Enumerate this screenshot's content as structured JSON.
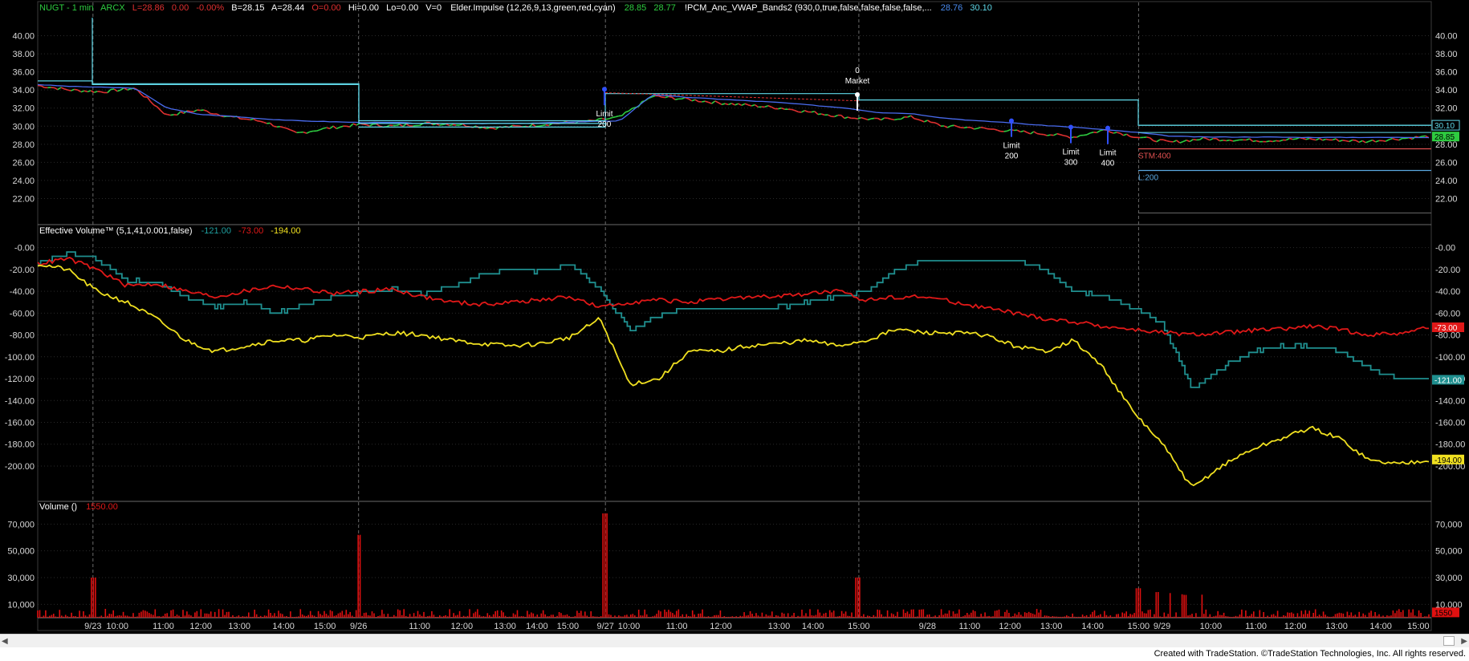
{
  "header": {
    "symbol": "NUGT - 1 min",
    "exchange": "ARCX",
    "last": "L=28.86",
    "chg": "0.00",
    "chg_pct": "-0.00%",
    "bid": "B=28.15",
    "ask": "A=28.44",
    "open": "O=0.00",
    "hi": "Hi=0.00",
    "lo": "Lo=0.00",
    "vol": "V=0",
    "impulse": "Elder.Impulse (12,26,9,13,green,red,cyan)",
    "impulse_v1": "28.85",
    "impulse_v2": "28.77",
    "vwap": "!PCM_Anc_VWAP_Bands2 (930,0,true,false,false,false,false,...",
    "vwap_v1": "28.76",
    "vwap_v2": "30.10"
  },
  "colors": {
    "background": "#000000",
    "price_up": "#2ecc40",
    "price_down": "#e03030",
    "vwap": "#4a6cf0",
    "bands": "#5fd8e8",
    "ev_teal": "#1f8f8f",
    "ev_red": "#e01818",
    "ev_yellow": "#f0e020",
    "volume": "#e01010",
    "grid": "#2a2a2a",
    "axis_text": "#d8d8d8"
  },
  "chart_data": [
    {
      "type": "line",
      "panel": "price",
      "title": "NUGT - 1 min",
      "ylim": [
        20,
        42
      ],
      "yticks": [
        "40.00",
        "38.00",
        "36.00",
        "34.00",
        "32.00",
        "30.00",
        "28.00",
        "26.00",
        "24.00",
        "22.00"
      ],
      "xticks": [
        "9/23",
        "10:00",
        "11:00",
        "12:00",
        "13:00",
        "14:00",
        "15:00",
        "9/26",
        "11:00",
        "12:00",
        "13:00",
        "14:00",
        "15:00",
        "9/27",
        "10:00",
        "11:00",
        "12:00",
        "13:00",
        "14:00",
        "15:00",
        "9/28",
        "11:00",
        "12:00",
        "13:00",
        "14:00",
        "15:00",
        "9/29",
        "10:00",
        "11:00",
        "12:00",
        "13:00",
        "14:00",
        "15:00"
      ],
      "series": [
        {
          "name": "NUGT",
          "values": [
            34.5,
            34.0,
            33.8,
            34.2,
            31.2,
            31.8,
            31.0,
            30.5,
            29.2,
            29.8,
            30.2,
            30.0,
            30.3,
            30.2,
            29.8,
            30.0,
            30.3,
            30.5,
            31.0,
            33.3,
            33.0,
            32.6,
            32.3,
            32.0,
            31.5,
            31.0,
            30.7,
            31.0,
            30.0,
            29.8,
            29.5,
            29.2,
            28.8,
            29.6,
            28.8,
            28.2,
            28.6,
            28.5,
            28.4,
            28.6,
            28.5,
            28.3,
            28.6,
            28.86
          ]
        },
        {
          "name": "VWAP",
          "values": [
            34.6,
            34.4,
            34.3,
            34.2,
            32.0,
            31.3,
            31.1,
            30.8,
            30.6,
            30.5,
            30.4,
            30.4,
            30.3,
            30.3,
            30.3,
            30.3,
            30.4,
            30.5,
            30.6,
            33.5,
            33.2,
            33.0,
            32.8,
            32.6,
            32.3,
            32.0,
            31.5,
            31.4,
            30.9,
            30.6,
            30.4,
            30.1,
            29.9,
            29.6,
            29.3,
            28.9,
            28.8,
            28.8,
            28.8,
            28.76,
            28.76,
            28.76,
            28.76,
            28.76
          ]
        }
      ],
      "order_labels": [
        {
          "line1": "Limit",
          "line2": "200"
        },
        {
          "line1": "0",
          "line2": "Market"
        },
        {
          "line1": "Limit",
          "line2": "200"
        },
        {
          "line1": "Limit",
          "line2": "300"
        },
        {
          "line1": "Limit",
          "line2": "400"
        }
      ],
      "order_lines": [
        {
          "label": "STM:400",
          "value": 27.5
        },
        {
          "label": "L:200",
          "value": 25.1
        }
      ],
      "price_markers": [
        "30.10",
        "28.85"
      ]
    },
    {
      "type": "line",
      "panel": "effective_volume",
      "title": "Effective Volume™ (5,1,41,0.001,false)",
      "ylim": [
        -225,
        10
      ],
      "yticks": [
        "-0.00",
        "-20.00",
        "-40.00",
        "-60.00",
        "-80.00",
        "-100.00",
        "-120.00",
        "-140.00",
        "-160.00",
        "-180.00",
        "-200.00"
      ],
      "last_values": [
        "-121.00",
        "-73.00",
        "-194.00"
      ],
      "series": [
        {
          "values": [
            -15,
            -5,
            -10,
            -30,
            -32,
            -45,
            -55,
            -50,
            -60,
            -52,
            -45,
            -40,
            -38,
            -42,
            -35,
            -25,
            -20,
            -22,
            -15,
            -40,
            -75,
            -62,
            -55,
            -55,
            -55,
            -55,
            -50,
            -45,
            -40,
            -20,
            -12,
            -12,
            -12,
            -12,
            -20,
            -40,
            -45,
            -55,
            -70,
            -130,
            -110,
            -95,
            -90,
            -90,
            -95,
            -110,
            -120,
            -121
          ]
        },
        {
          "values": [
            -15,
            -10,
            -20,
            -35,
            -33,
            -40,
            -45,
            -40,
            -35,
            -38,
            -42,
            -40,
            -38,
            -45,
            -50,
            -52,
            -50,
            -48,
            -45,
            -55,
            -50,
            -48,
            -50,
            -48,
            -45,
            -45,
            -42,
            -40,
            -48,
            -45,
            -45,
            -50,
            -55,
            -60,
            -65,
            -68,
            -72,
            -75,
            -78,
            -80,
            -78,
            -76,
            -75,
            -72,
            -75,
            -80,
            -78,
            -73
          ]
        },
        {
          "values": [
            -15,
            -20,
            -40,
            -50,
            -65,
            -85,
            -95,
            -90,
            -85,
            -85,
            -80,
            -82,
            -78,
            -80,
            -85,
            -88,
            -90,
            -88,
            -82,
            -65,
            -125,
            -120,
            -95,
            -95,
            -90,
            -88,
            -85,
            -90,
            -85,
            -75,
            -78,
            -78,
            -80,
            -90,
            -95,
            -85,
            -110,
            -150,
            -180,
            -220,
            -200,
            -185,
            -175,
            -165,
            -175,
            -195,
            -198,
            -194
          ]
        }
      ]
    },
    {
      "type": "bar",
      "panel": "volume",
      "title": "Volume ()",
      "last_value": "1550.00",
      "last_label": "1550",
      "ylim": [
        0,
        78000
      ],
      "yticks": [
        "70,000",
        "50,000",
        "30,000",
        "10,000"
      ]
    }
  ],
  "footer": {
    "credit": "Created with TradeStation. ©TradeStation Technologies, Inc. All rights reserved."
  }
}
